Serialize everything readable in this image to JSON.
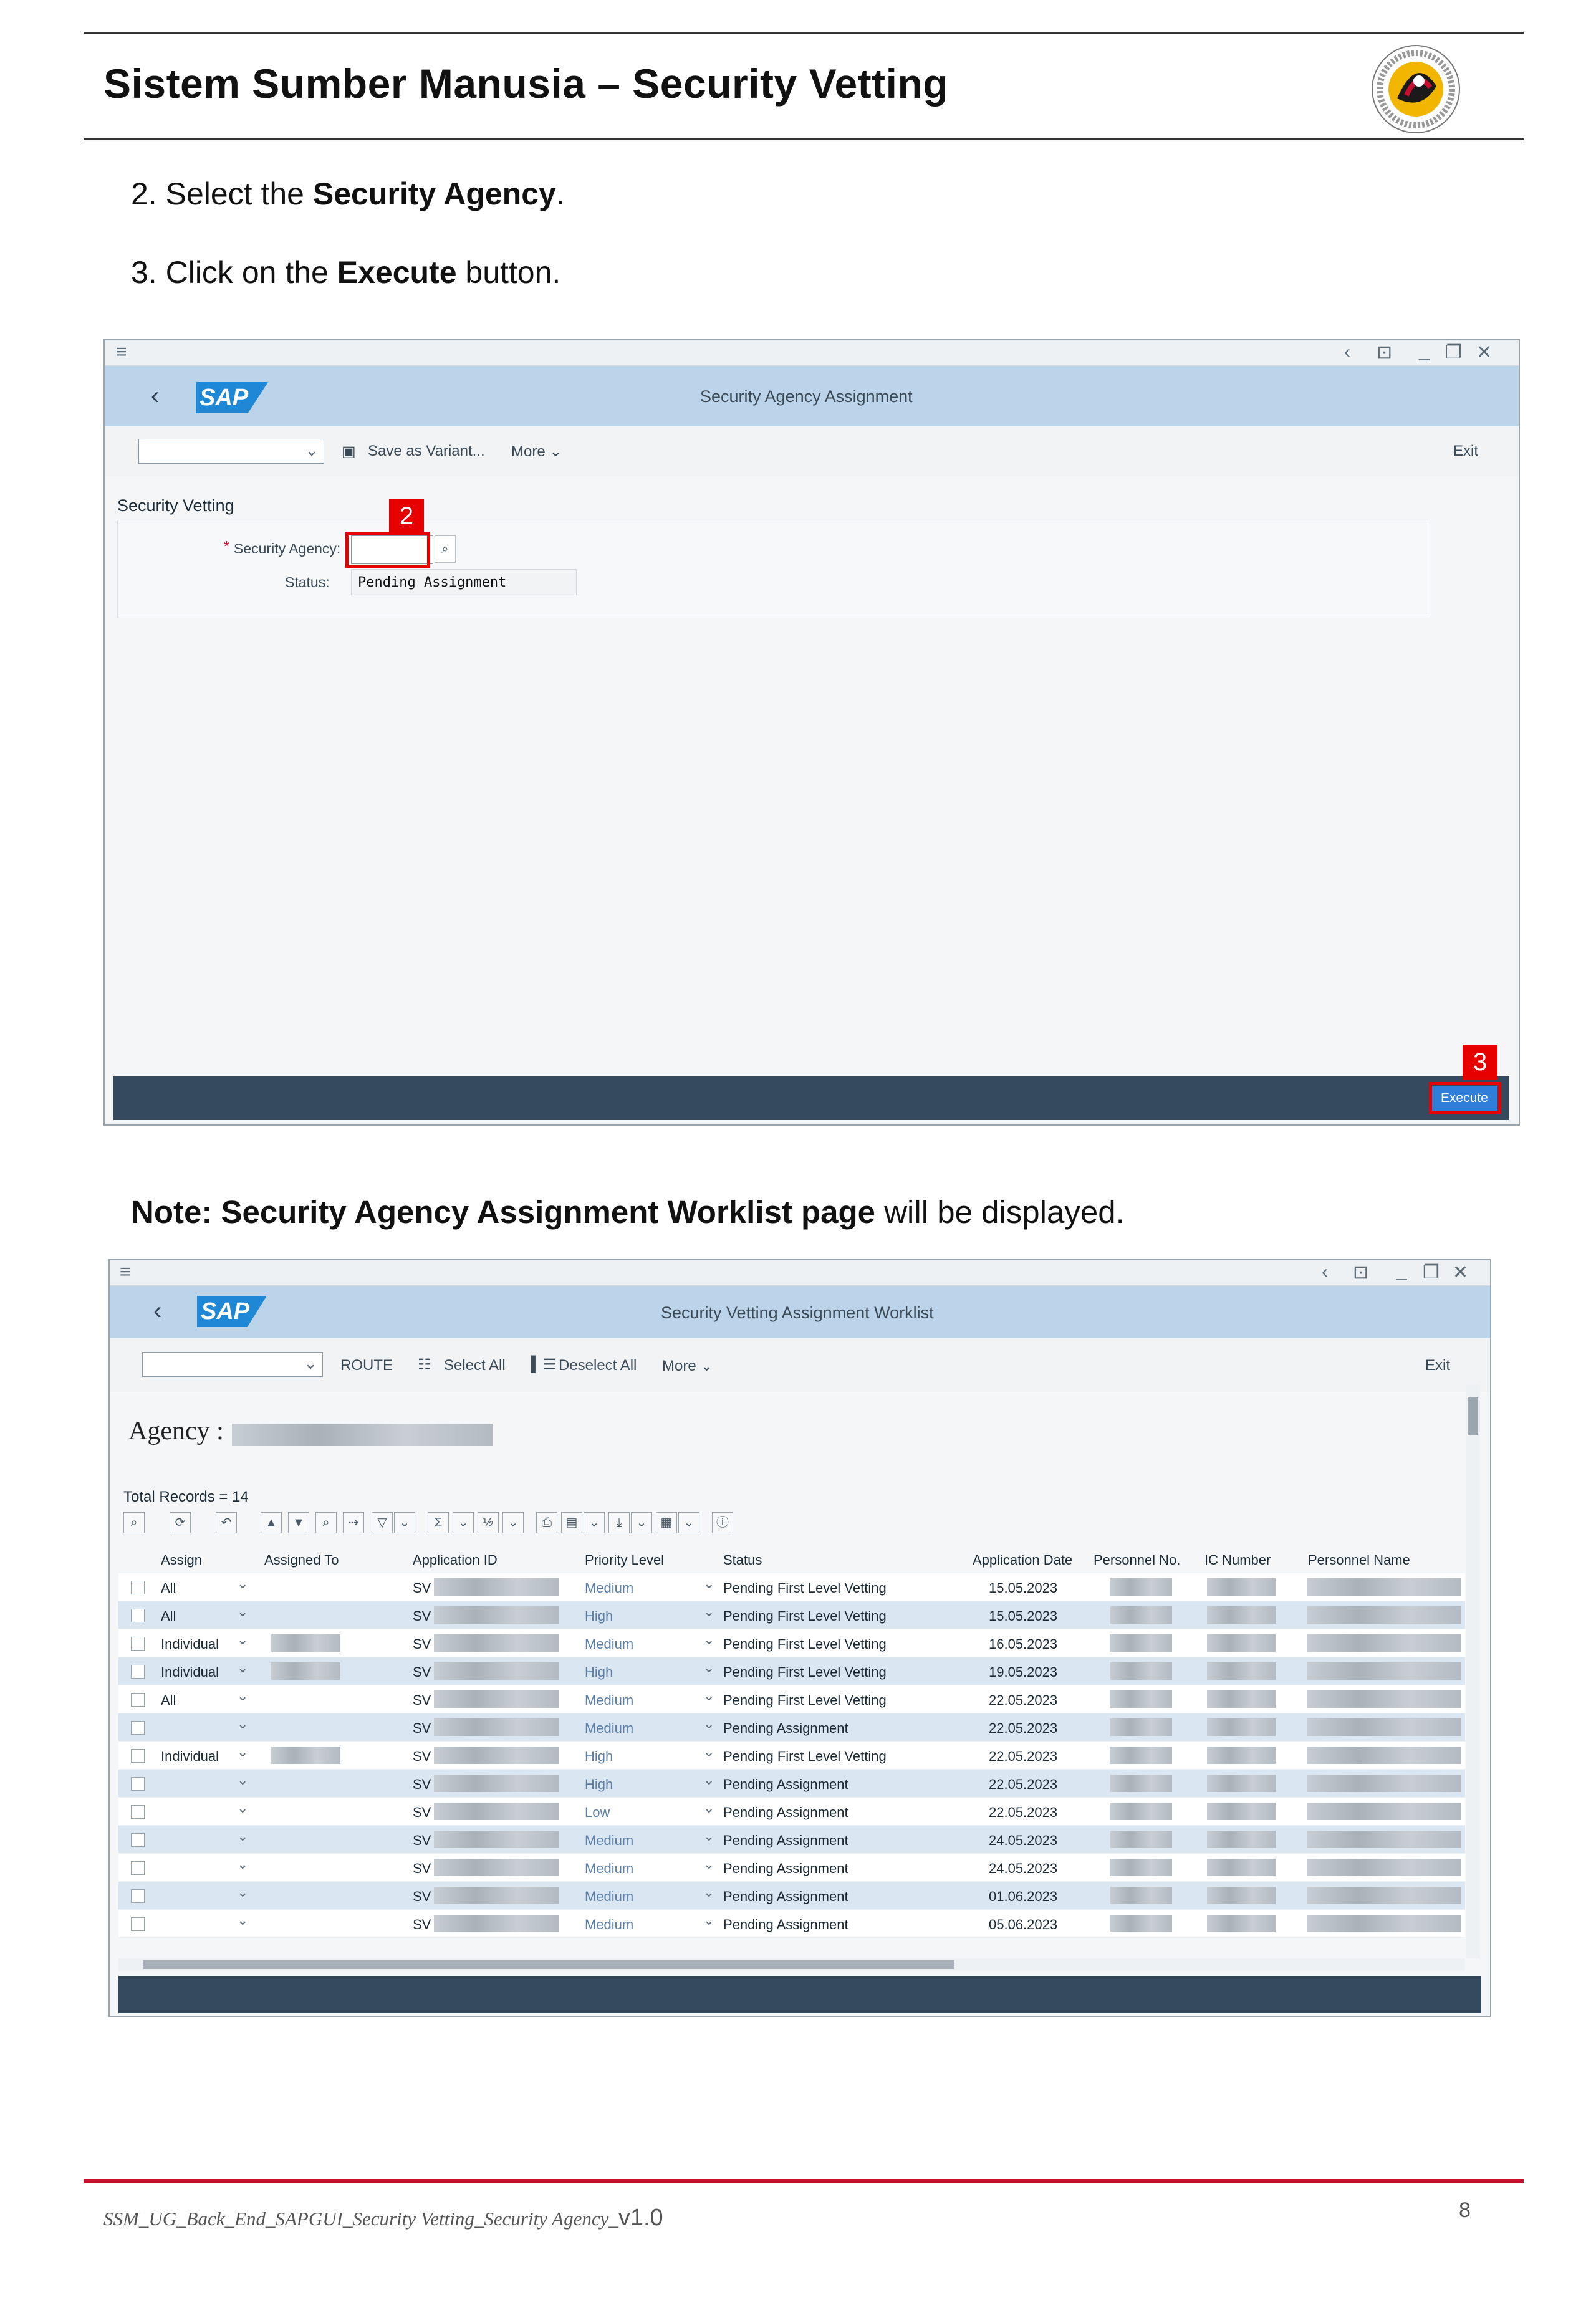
{
  "header": {
    "title": "Sistem Sumber Manusia – Security Vetting"
  },
  "steps": [
    {
      "num": "2.",
      "pre": "Select the ",
      "bold": "Security Agency",
      "post": "."
    },
    {
      "num": "3.",
      "pre": "Click on the ",
      "bold": "Execute",
      "post": " button."
    }
  ],
  "screen1": {
    "shell_title": "Security Agency Assignment",
    "sap_logo": "SAP",
    "toolbar": {
      "save_variant": "Save as Variant...",
      "more": "More",
      "exit": "Exit"
    },
    "section_title": "Security Vetting",
    "fields": {
      "agency_label": "Security Agency:",
      "agency_value": "",
      "status_label": "Status:",
      "status_value": "Pending Assignment"
    },
    "markers": {
      "agency": "2",
      "execute": "3"
    },
    "execute_label": "Execute"
  },
  "note": {
    "bold": "Note: Security Agency Assignment Worklist page",
    "rest": " will be displayed."
  },
  "screen2": {
    "shell_title": "Security Vetting Assignment Worklist",
    "sap_logo": "SAP",
    "toolbar": {
      "route": "ROUTE",
      "select_all": "Select All",
      "deselect_all": "Deselect All",
      "more": "More",
      "exit": "Exit"
    },
    "agency_label": "Agency :",
    "total_records": "Total Records = 14",
    "columns": [
      "Assign",
      "Assigned To",
      "Application ID",
      "Priority Level",
      "Status",
      "Application Date",
      "Personnel No.",
      "IC Number",
      "Personnel Name"
    ],
    "rows": [
      {
        "assign": "All",
        "assigned_blur": false,
        "app_id": "SV",
        "priority": "Medium",
        "status": "Pending First Level Vetting",
        "date": "15.05.2023",
        "hl": false
      },
      {
        "assign": "All",
        "assigned_blur": false,
        "app_id": "SV",
        "priority": "High",
        "status": "Pending First Level Vetting",
        "date": "15.05.2023",
        "hl": true
      },
      {
        "assign": "Individual",
        "assigned_blur": true,
        "app_id": "SV",
        "priority": "Medium",
        "status": "Pending First Level Vetting",
        "date": "16.05.2023",
        "hl": false
      },
      {
        "assign": "Individual",
        "assigned_blur": true,
        "app_id": "SV",
        "priority": "High",
        "status": "Pending First Level Vetting",
        "date": "19.05.2023",
        "hl": true
      },
      {
        "assign": "All",
        "assigned_blur": false,
        "app_id": "SV",
        "priority": "Medium",
        "status": "Pending First Level Vetting",
        "date": "22.05.2023",
        "hl": false
      },
      {
        "assign": "",
        "assigned_blur": false,
        "app_id": "SV",
        "priority": "Medium",
        "status": "Pending Assignment",
        "date": "22.05.2023",
        "hl": true
      },
      {
        "assign": "Individual",
        "assigned_blur": true,
        "app_id": "SV",
        "priority": "High",
        "status": "Pending First Level Vetting",
        "date": "22.05.2023",
        "hl": false
      },
      {
        "assign": "",
        "assigned_blur": false,
        "app_id": "SV",
        "priority": "High",
        "status": "Pending Assignment",
        "date": "22.05.2023",
        "hl": true
      },
      {
        "assign": "",
        "assigned_blur": false,
        "app_id": "SV",
        "priority": "Low",
        "status": "Pending Assignment",
        "date": "22.05.2023",
        "hl": false
      },
      {
        "assign": "",
        "assigned_blur": false,
        "app_id": "SV",
        "priority": "Medium",
        "status": "Pending Assignment",
        "date": "24.05.2023",
        "hl": true
      },
      {
        "assign": "",
        "assigned_blur": false,
        "app_id": "SV",
        "priority": "Medium",
        "status": "Pending Assignment",
        "date": "24.05.2023",
        "hl": false
      },
      {
        "assign": "",
        "assigned_blur": false,
        "app_id": "SV",
        "priority": "Medium",
        "status": "Pending Assignment",
        "date": "01.06.2023",
        "hl": true
      },
      {
        "assign": "",
        "assigned_blur": false,
        "app_id": "SV",
        "priority": "Medium",
        "status": "Pending Assignment",
        "date": "05.06.2023",
        "hl": false
      }
    ]
  },
  "footer": {
    "doc_name": "SSM_UG_Back_End_SAPGUI_Security Vetting_Security Agency_",
    "version": "v1.0",
    "page": "8"
  }
}
